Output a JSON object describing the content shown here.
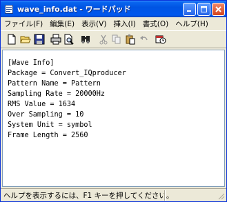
{
  "window": {
    "title": "wave_info.dat - ワードパッド",
    "controls": {
      "minimize_icon": "minimize-icon",
      "maximize_icon": "maximize-icon",
      "close_icon": "close-icon"
    }
  },
  "menu": {
    "items": [
      {
        "label": "ファイル(F)"
      },
      {
        "label": "編集(E)"
      },
      {
        "label": "表示(V)"
      },
      {
        "label": "挿入(I)"
      },
      {
        "label": "書式(O)"
      },
      {
        "label": "ヘルプ(H)"
      }
    ]
  },
  "toolbar": {
    "icons": [
      "new-document-icon",
      "open-folder-icon",
      "save-icon",
      "print-icon",
      "print-preview-icon",
      "find-icon",
      "cut-icon",
      "copy-icon",
      "paste-icon",
      "undo-icon",
      "insert-date-time-icon"
    ]
  },
  "document": {
    "lines": [
      "[Wave Info]",
      "Package = Convert_IQproducer",
      "Pattern Name = Pattern",
      "Sampling Rate = 20000Hz",
      "RMS Value = 1634",
      "Over Sampling = 10",
      "System Unit = symbol",
      "Frame Length = 2560"
    ]
  },
  "status": {
    "help_text": "ヘルプを表示するには、F1 キーを押してください。"
  }
}
